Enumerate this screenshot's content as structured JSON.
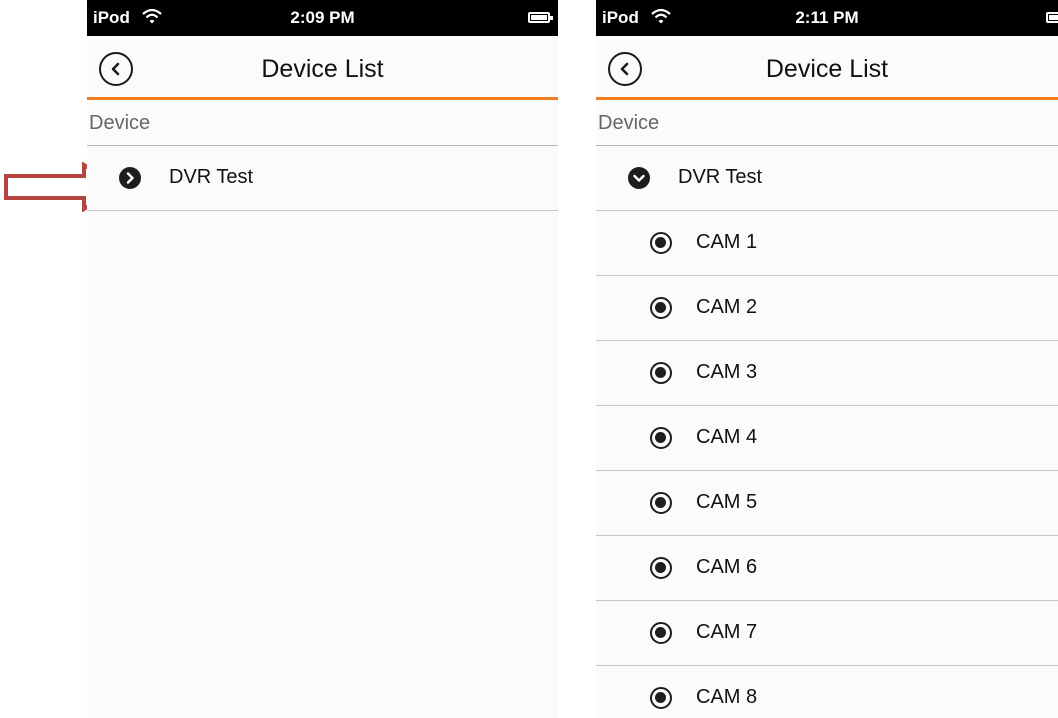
{
  "screens": [
    {
      "statusbar": {
        "carrier": "iPod",
        "time": "2:09 PM"
      },
      "navbar": {
        "title": "Device List"
      },
      "section_header": "Device",
      "device": {
        "name": "DVR Test",
        "expanded": false
      },
      "cameras": []
    },
    {
      "statusbar": {
        "carrier": "iPod",
        "time": "2:11 PM"
      },
      "navbar": {
        "title": "Device List"
      },
      "section_header": "Device",
      "device": {
        "name": "DVR Test",
        "expanded": true
      },
      "cameras": [
        "CAM 1",
        "CAM 2",
        "CAM 3",
        "CAM 4",
        "CAM 5",
        "CAM 6",
        "CAM 7",
        "CAM 8"
      ]
    }
  ],
  "icons": {
    "back": "chevron-left-icon",
    "collapsed": "chevron-right-circle-icon",
    "expanded": "chevron-down-circle-icon",
    "camera": "radio-camera-icon",
    "annotation": "red-arrow-icon"
  },
  "colors": {
    "accent": "#f07d23",
    "annotation_arrow": "#b5453f",
    "icon_dark": "#1e1e1e"
  }
}
